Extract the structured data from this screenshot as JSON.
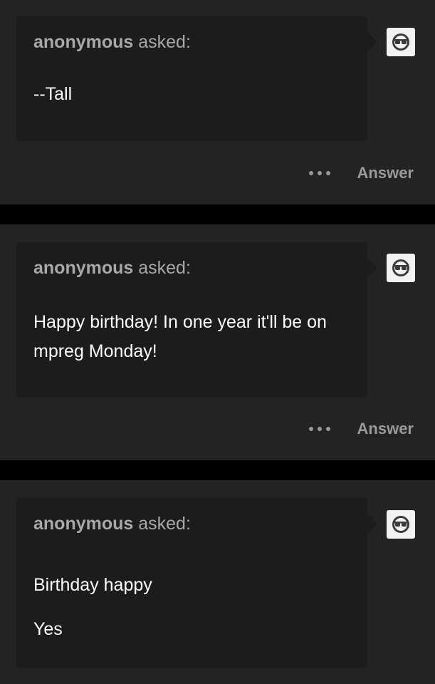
{
  "asks": [
    {
      "asker": "anonymous",
      "asked_label": "asked:",
      "lines": [
        "--Tall"
      ],
      "answer_label": "Answer"
    },
    {
      "asker": "anonymous",
      "asked_label": "asked:",
      "lines": [
        "Happy birthday! In one year it'll be on mpreg Monday!"
      ],
      "answer_label": "Answer"
    },
    {
      "asker": "anonymous",
      "asked_label": "asked:",
      "lines": [
        "Birthday happy",
        "Yes"
      ]
    }
  ],
  "icons": {
    "avatar": "anonymous-avatar-icon",
    "more": "more-options-icon"
  },
  "colors": {
    "page_background": "#000000",
    "card_background": "#232323",
    "bubble_background": "#1c1c1c",
    "muted_text": "#a8a8a8",
    "question_text": "#ffffff"
  }
}
